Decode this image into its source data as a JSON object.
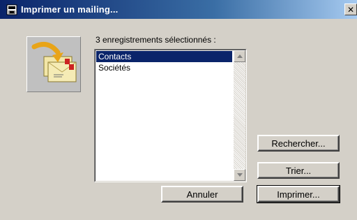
{
  "window": {
    "title": "Imprimer un mailing...",
    "close_glyph": "✕"
  },
  "icons": {
    "title_icon": "print-window-icon",
    "app_icon": "mailing-envelopes-icon",
    "close_icon": "close-icon",
    "scroll_up_icon": "scroll-up-arrow-icon",
    "scroll_down_icon": "scroll-down-arrow-icon"
  },
  "selection": {
    "caption": "3 enregistrements sélectionnés :",
    "items": [
      {
        "label": "Contacts",
        "selected": true
      },
      {
        "label": "Sociétés",
        "selected": false
      }
    ]
  },
  "buttons": {
    "search": "Rechercher...",
    "sort": "Trier...",
    "cancel": "Annuler",
    "print": "Imprimer..."
  },
  "colors": {
    "face": "#d4d0c8",
    "title_start": "#0a246a",
    "title_end": "#a6caf0",
    "selection": "#0a246a"
  }
}
